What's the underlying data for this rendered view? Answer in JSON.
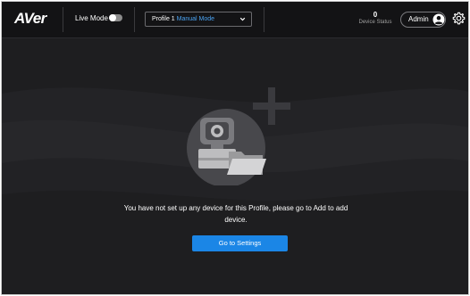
{
  "header": {
    "logo_text": "AVer",
    "live_mode_label": "Live Mode",
    "live_mode_on": false,
    "profile": {
      "name": "Profile 1",
      "mode": "Manual Mode"
    },
    "device_status": {
      "count": "0",
      "label": "Device Status"
    },
    "user": {
      "name": "Admin"
    }
  },
  "main": {
    "empty_message": "You have not set up any device for this Profile, please go to Add to add device.",
    "go_button_label": "Go to Settings"
  },
  "colors": {
    "background": "#1e1e20",
    "topbar": "#131315",
    "accent": "#1b86e6",
    "mode_text": "#4aa2f0"
  },
  "icons": [
    "chevron-down-icon",
    "user-icon",
    "gear-icon",
    "camera-icon",
    "folder-icon",
    "plus-icon"
  ]
}
